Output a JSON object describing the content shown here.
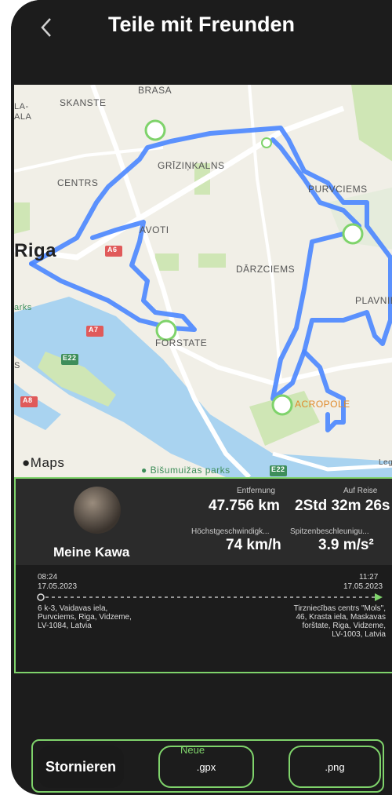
{
  "header": {
    "title": "Teile mit Freunden"
  },
  "map": {
    "labels": [
      "BRASA",
      "SKANSTE",
      "CENTRS",
      "GRĪZIŅKALNS",
      "AVOTI",
      "Riga",
      "DĀRZCIEMS",
      "PLAVNIEKI",
      "FORSTATE",
      "ACROPOLE",
      "PURVCIEMS",
      "A6",
      "A7",
      "A8",
      "E22",
      "Maps",
      "Bišumuižas parks",
      "Legal",
      "E22",
      "LA-",
      "ALA",
      "arks",
      "S"
    ]
  },
  "card": {
    "name": "Meine Kawa",
    "distance_label": "Entfernung",
    "distance_value": "47.756 km",
    "duration_label": "Auf Reise",
    "duration_value": "2Std 32m 26s",
    "speed_label": "Höchstgeschwindigk...",
    "speed_value": "74 km/h",
    "accel_label": "Spitzenbeschleunigu...",
    "accel_value": "3.9 m/s²",
    "start_time": "08:24",
    "start_date": "17.05.2023",
    "end_time": "11:27",
    "end_date": "17.05.2023",
    "start_address_1": "6 k-3, Vaidavas iela,",
    "start_address_2": "Purvciems, Riga, Vidzeme,",
    "start_address_3": "LV-1084, Latvia",
    "end_address_1": "Tirzniecības centrs \"Mols\",",
    "end_address_2": "46, Krasta iela, Maskavas",
    "end_address_3": "forštate, Riga, Vidzeme,",
    "end_address_4": "LV-1003, Latvia"
  },
  "actions": {
    "cancel": "Stornieren",
    "gpx": ".gpx",
    "gpx_badge": "Neue",
    "png": ".png"
  },
  "colors": {
    "accent": "#7fd36b",
    "route": "#4a86ff",
    "background": "#1c1c1c"
  }
}
